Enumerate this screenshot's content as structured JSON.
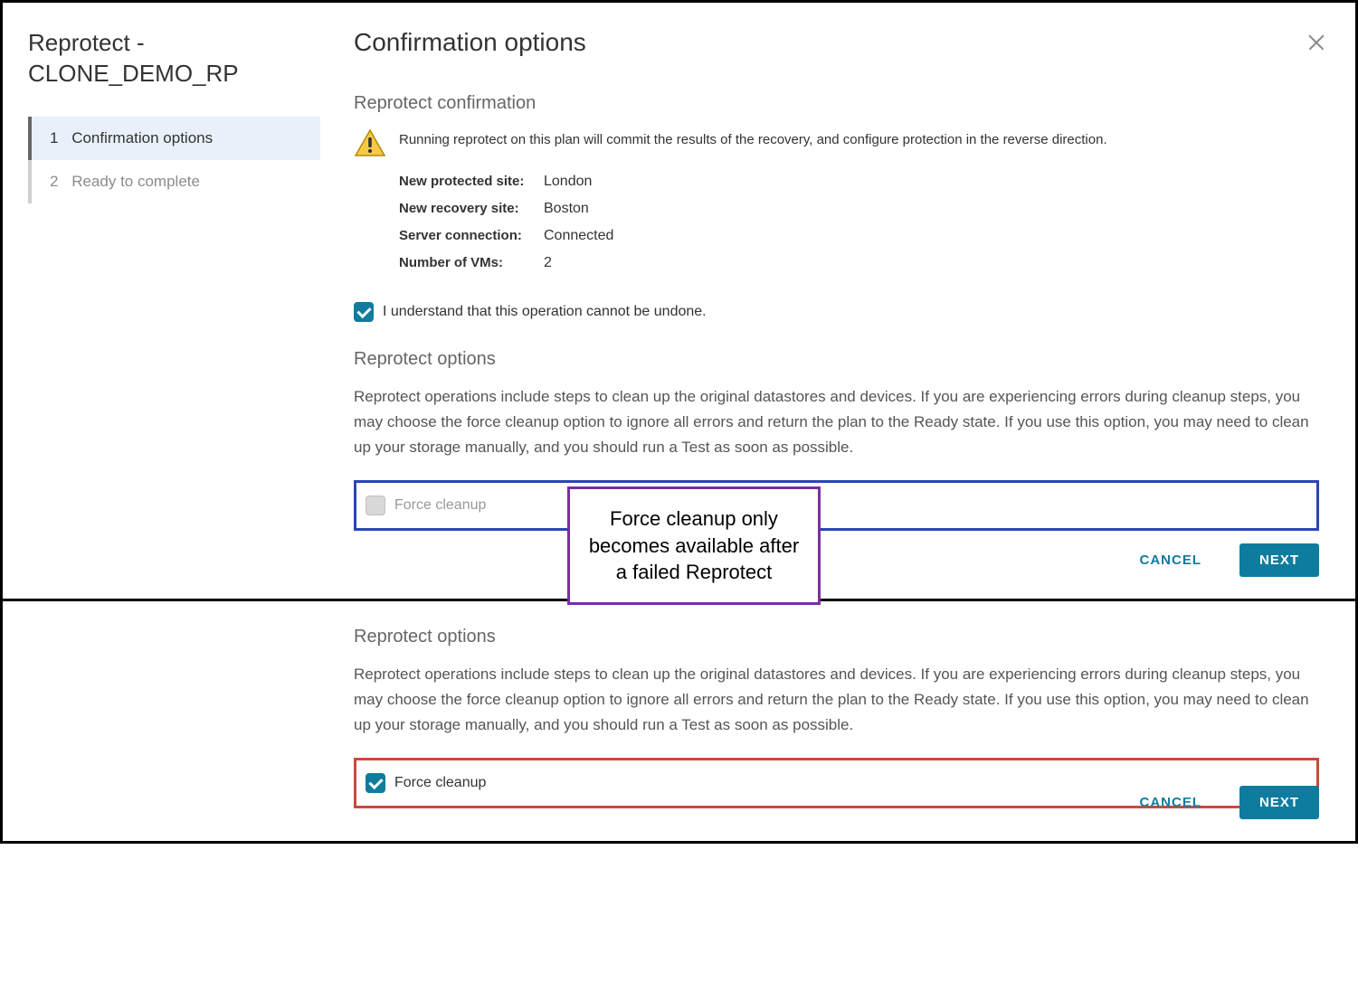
{
  "sidebar": {
    "title_line1": "Reprotect -",
    "title_line2": "CLONE_DEMO_RP",
    "steps": [
      {
        "num": "1",
        "label": "Confirmation options"
      },
      {
        "num": "2",
        "label": "Ready to complete"
      }
    ]
  },
  "header": {
    "title": "Confirmation options"
  },
  "confirmation": {
    "heading": "Reprotect confirmation",
    "warning": "Running reprotect on this plan will commit the results of the recovery, and configure protection in the reverse direction.",
    "fields": {
      "protected_site_label": "New protected site:",
      "protected_site_value": "London",
      "recovery_site_label": "New recovery site:",
      "recovery_site_value": "Boston",
      "server_conn_label": "Server connection:",
      "server_conn_value": "Connected",
      "vm_count_label": "Number of VMs:",
      "vm_count_value": "2"
    },
    "ack_checkbox": "I understand that this operation cannot be undone."
  },
  "options": {
    "heading": "Reprotect options",
    "description": "Reprotect operations include steps to clean up the original datastores and devices. If you are experiencing errors during cleanup steps, you may choose the force cleanup option to ignore all errors and return the plan to the Ready state. If you use this option, you may need to clean up your storage manually, and you should run a Test as soon as possible.",
    "force_cleanup_label": "Force cleanup"
  },
  "buttons": {
    "cancel": "CANCEL",
    "next": "NEXT"
  },
  "annotation": "Force cleanup only becomes available after a failed Reprotect"
}
